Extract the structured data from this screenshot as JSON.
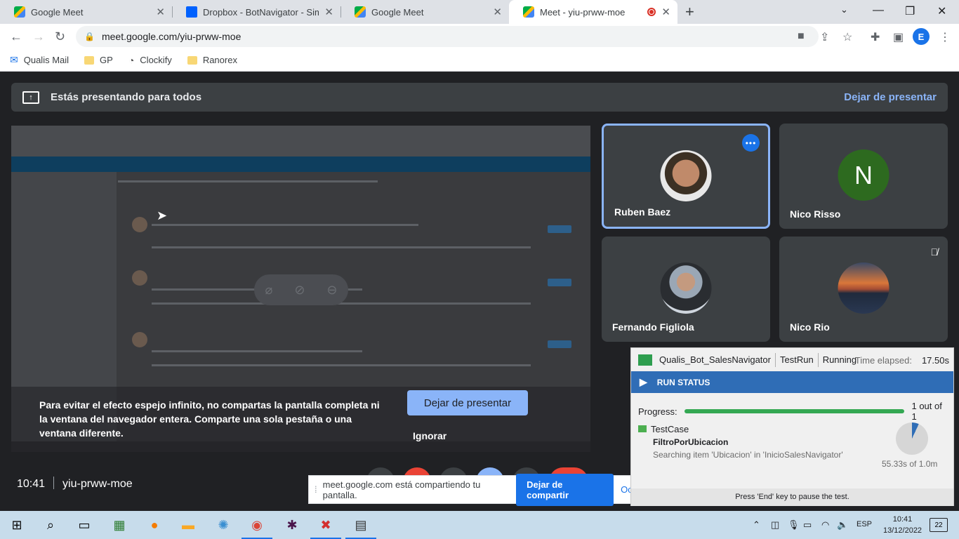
{
  "browser": {
    "tabs": [
      {
        "title": "Google Meet",
        "favicon": "meet-icon"
      },
      {
        "title": "Dropbox - BotNavigator - Simplif",
        "favicon": "dropbox-icon"
      },
      {
        "title": "Google Meet",
        "favicon": "meet-icon"
      },
      {
        "title": "Meet - yiu-prww-moe",
        "favicon": "meet-icon"
      }
    ],
    "url": "meet.google.com/yiu-prww-moe",
    "profile_initial": "E",
    "bookmarks": [
      "Qualis Mail",
      "GP",
      "Clockify",
      "Ranorex"
    ]
  },
  "meet": {
    "banner_text": "Estás presentando para todos",
    "banner_stop": "Dejar de presentar",
    "mirror_warning": "Para evitar el efecto espejo infinito, no compartas la pantalla completa ni la ventana del navegador entera. Comparte una sola pestaña o una ventana diferente.",
    "mirror_stop": "Dejar de presentar",
    "mirror_ignore": "Ignorar",
    "participants": [
      {
        "name": "Ruben Baez"
      },
      {
        "name": "Nico Risso",
        "initial": "N"
      },
      {
        "name": "Fernando Figliola"
      },
      {
        "name": "Nico Rio"
      }
    ],
    "time": "10:41",
    "meeting_code": "yiu-prww-moe"
  },
  "sharing_bar": {
    "text": "meet.google.com está compartiendo tu pantalla.",
    "stop": "Dejar de compartir",
    "hide": "Ocu"
  },
  "runner": {
    "bot": "Qualis_Bot_SalesNavigator",
    "mode": "TestRun",
    "state": "Running",
    "elapsed_label": "Time elapsed:",
    "elapsed": "17.50s",
    "status_title": "RUN STATUS",
    "progress_label": "Progress:",
    "progress_fraction": 1.0,
    "progress_text": "1 out of 1",
    "testcase_label": "TestCase",
    "testcase_name": "FiltroPorUbicacion",
    "testcase_step": "Searching item 'Ubicacion' in 'InicioSalesNavigator'",
    "pie_fraction": 0.07,
    "pie_text": "55.33s of 1.0m",
    "footer": "Press 'End' key to pause the test.",
    "colors": {
      "header": "#2f6db6",
      "progress": "#34a853"
    }
  },
  "taskbar": {
    "lang": "ESP",
    "time": "10:41",
    "date": "13/12/2022",
    "notifications": "22"
  }
}
